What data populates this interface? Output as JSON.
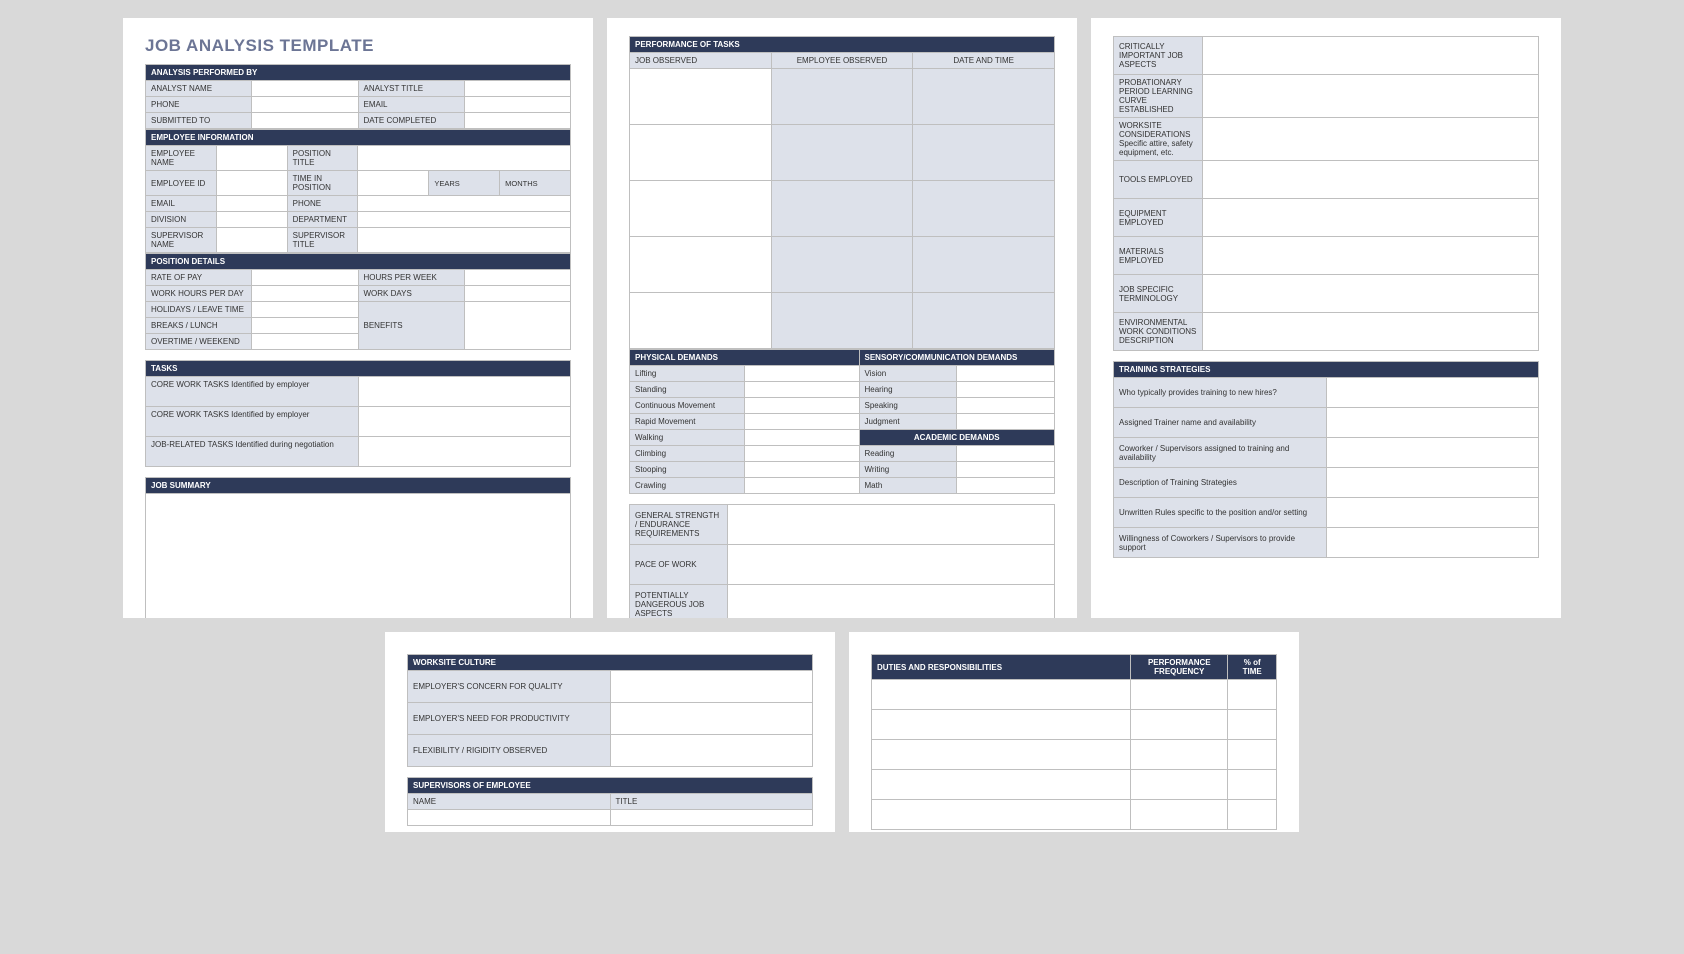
{
  "title": "JOB ANALYSIS TEMPLATE",
  "sections": {
    "analysis_performed_by": "ANALYSIS PERFORMED BY",
    "employee_information": "EMPLOYEE INFORMATION",
    "position_details": "POSITION DETAILS",
    "tasks": "TASKS",
    "job_summary": "JOB SUMMARY",
    "performance_of_tasks": "PERFORMANCE OF TASKS",
    "physical_demands": "PHYSICAL DEMANDS",
    "sensory_demands": "SENSORY/COMMUNICATION DEMANDS",
    "academic_demands": "ACADEMIC DEMANDS",
    "training_strategies": "TRAINING STRATEGIES",
    "worksite_culture": "WORKSITE CULTURE",
    "supervisors": "SUPERVISORS OF EMPLOYEE",
    "duties": "DUTIES AND RESPONSIBILITIES"
  },
  "labels": {
    "analyst_name": "ANALYST NAME",
    "analyst_title": "ANALYST TITLE",
    "phone": "PHONE",
    "email": "EMAIL",
    "submitted_to": "SUBMITTED TO",
    "date_completed": "DATE COMPLETED",
    "employee_name": "EMPLOYEE NAME",
    "position_title": "POSITION TITLE",
    "employee_id": "EMPLOYEE ID",
    "time_in_position": "TIME IN POSITION",
    "years": "YEARS",
    "months": "MONTHS",
    "division": "DIVISION",
    "department": "DEPARTMENT",
    "supervisor_name": "SUPERVISOR NAME",
    "supervisor_title": "SUPERVISOR TITLE",
    "rate_of_pay": "RATE OF PAY",
    "hours_per_week": "HOURS PER WEEK",
    "work_hours_per_day": "WORK HOURS PER DAY",
    "work_days": "WORK DAYS",
    "holidays": "HOLIDAYS / LEAVE TIME",
    "breaks": "BREAKS / LUNCH",
    "benefits": "BENEFITS",
    "overtime": "OVERTIME / WEEKEND",
    "core_work_tasks": "CORE WORK TASKS Identified by employer",
    "job_related_tasks": "JOB-RELATED TASKS Identified during negotiation",
    "job_observed": "JOB OBSERVED",
    "employee_observed": "EMPLOYEE OBSERVED",
    "date_and_time": "DATE AND TIME",
    "lifting": "Lifting",
    "standing": "Standing",
    "continuous_movement": "Continuous Movement",
    "rapid_movement": "Rapid Movement",
    "walking": "Walking",
    "climbing": "Climbing",
    "stooping": "Stooping",
    "crawling": "Crawling",
    "vision": "Vision",
    "hearing": "Hearing",
    "speaking": "Speaking",
    "judgment": "Judgment",
    "reading": "Reading",
    "writing": "Writing",
    "math": "Math",
    "general_strength": "GENERAL STRENGTH / ENDURANCE REQUIREMENTS",
    "pace_of_work": "PACE OF WORK",
    "dangerous": "POTENTIALLY DANGEROUS JOB ASPECTS",
    "critically_important": "CRITICALLY IMPORTANT JOB ASPECTS",
    "probationary": "PROBATIONARY PERIOD LEARNING CURVE ESTABLISHED",
    "worksite_considerations": "WORKSITE CONSIDERATIONS Specific attire, safety equipment, etc.",
    "tools_employed": "TOOLS EMPLOYED",
    "equipment_employed": "EQUIPMENT EMPLOYED",
    "materials_employed": "MATERIALS EMPLOYED",
    "job_terminology": "JOB SPECIFIC TERMINOLOGY",
    "environmental": "ENVIRONMENTAL WORK CONDITIONS DESCRIPTION",
    "who_provides_training": "Who typically provides training to new hires?",
    "assigned_trainer": "Assigned Trainer name and availability",
    "coworker_supervisors": "Coworker / Supervisors assigned to training and availability",
    "training_desc": "Description of Training Strategies",
    "unwritten_rules": "Unwritten Rules specific to the position and/or setting",
    "willingness": "Willingness of Coworkers / Supervisors to provide support",
    "employer_quality": "EMPLOYER'S CONCERN FOR QUALITY",
    "employer_productivity": "EMPLOYER'S NEED FOR PRODUCTIVITY",
    "flexibility": "FLEXIBILITY / RIGIDITY OBSERVED",
    "name": "NAME",
    "title_col": "TITLE",
    "perf_frequency": "PERFORMANCE FREQUENCY",
    "pct_time": "% of TIME"
  }
}
